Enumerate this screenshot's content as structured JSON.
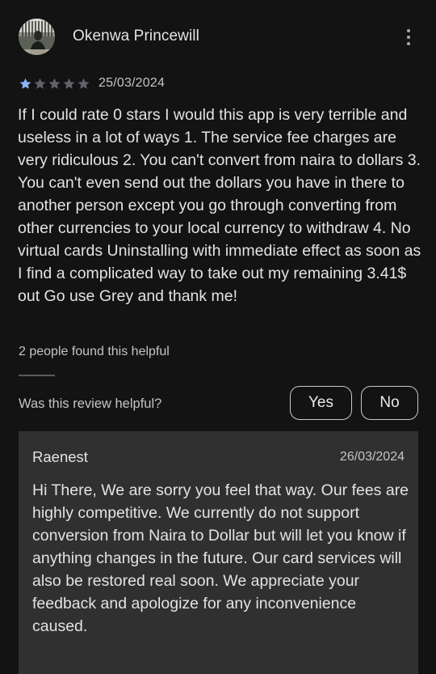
{
  "review": {
    "reviewer_name": "Okenwa Princewill",
    "rating": 1,
    "max_rating": 5,
    "date": "25/03/2024",
    "text": "If I could rate 0 stars I would this app is very terrible and useless in a lot of ways 1. The service fee charges are very ridiculous 2. You can't convert from naira to dollars 3. You can't even send out the dollars you have in there to another person except you go through converting from other currencies to your local currency to withdraw 4. No virtual cards Uninstalling with immediate effect as soon as I find a complicated way to take out my remaining 3.41$ out Go use Grey and thank me!",
    "helpful_count_text": "2 people found this helpful"
  },
  "feedback": {
    "question": "Was this review helpful?",
    "yes_label": "Yes",
    "no_label": "No"
  },
  "developer_reply": {
    "name": "Raenest",
    "date": "26/03/2024",
    "text": "Hi There, We are sorry you feel that way. Our fees are highly competitive. We currently do not support conversion from Naira to Dollar but will let you know if anything changes in the future. Our card services will also be restored real soon. We appreciate your feedback and apologize for any inconvenience caused."
  },
  "colors": {
    "background": "#131313",
    "star_filled": "#8ab4f8",
    "star_empty": "#5f6368",
    "reply_background": "#303030"
  },
  "icons": {
    "menu": "more-vert-icon",
    "star": "star-icon"
  }
}
